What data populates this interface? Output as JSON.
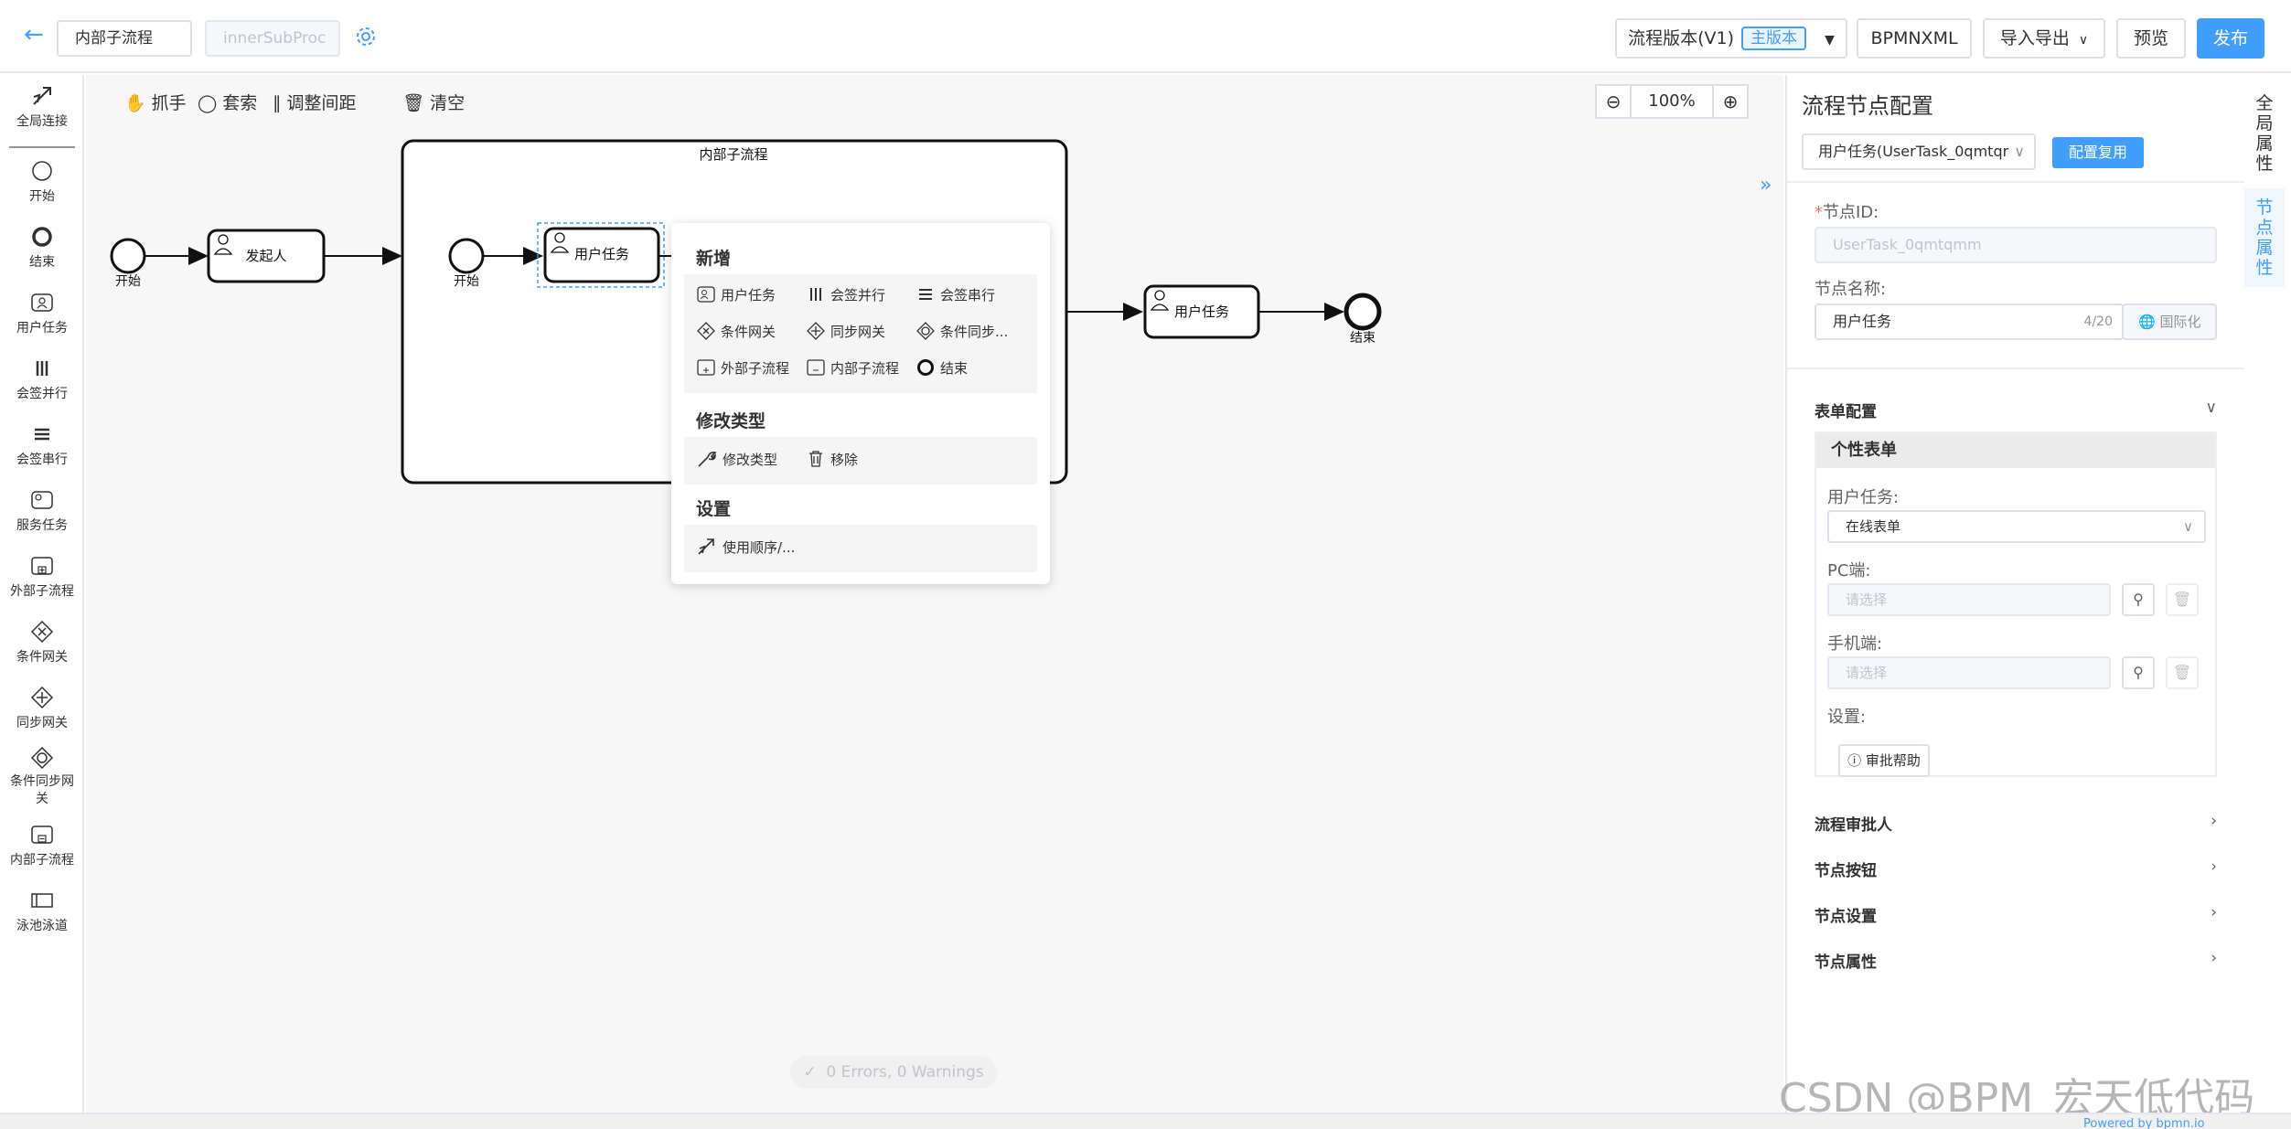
{
  "header": {
    "back_icon": "arrow-left-icon",
    "process_name": "内部子流程",
    "process_key": "innerSubProc",
    "version_label": "流程版本(V1)",
    "version_tag": "主版本",
    "bpmn_xml": "BPMNXML",
    "import_export": "导入导出",
    "preview": "预览",
    "publish": "发布",
    "accent": "#409eff"
  },
  "palette": {
    "items": [
      {
        "label": "全局连接",
        "icon": "global-connect-icon"
      },
      {
        "label": "开始",
        "icon": "start-event-icon"
      },
      {
        "label": "结束",
        "icon": "end-event-icon"
      },
      {
        "label": "用户任务",
        "icon": "user-task-icon"
      },
      {
        "label": "会签并行",
        "icon": "parallel-multi-icon"
      },
      {
        "label": "会签串行",
        "icon": "sequential-multi-icon"
      },
      {
        "label": "服务任务",
        "icon": "service-task-icon"
      },
      {
        "label": "外部子流程",
        "icon": "external-subprocess-icon"
      },
      {
        "label": "条件网关",
        "icon": "exclusive-gateway-icon"
      },
      {
        "label": "同步网关",
        "icon": "parallel-gateway-icon"
      },
      {
        "label": "条件同步网关",
        "icon": "inclusive-gateway-icon"
      },
      {
        "label": "内部子流程",
        "icon": "inner-subprocess-icon"
      },
      {
        "label": "泳池泳道",
        "icon": "pool-lane-icon"
      }
    ]
  },
  "toolbar": {
    "hand": "抓手",
    "lasso": "套索",
    "space": "调整间距",
    "clear": "清空",
    "zoom": "100%"
  },
  "diagram": {
    "subprocess_title": "内部子流程",
    "start1": "开始",
    "initiator": "发起人",
    "start2": "开始",
    "user_task_inner": "用户任务",
    "user_task_outer": "用户任务",
    "end": "结束"
  },
  "context_pad": {
    "add_title": "新增",
    "add_items": [
      "用户任务",
      "会签并行",
      "会签串行",
      "条件网关",
      "同步网关",
      "条件同步...",
      "外部子流程",
      "内部子流程",
      "结束"
    ],
    "modify_title": "修改类型",
    "modify_items": [
      "修改类型",
      "移除"
    ],
    "settings_title": "设置",
    "settings_items": [
      "使用顺序/..."
    ]
  },
  "status": "0 Errors, 0 Warnings",
  "panel": {
    "title": "流程节点配置",
    "node_select": "用户任务(UserTask_0qmtqr",
    "reuse_button": "配置复用",
    "node_id_label": "节点ID:",
    "node_id_value": "UserTask_0qmtqmm",
    "node_name_label": "节点名称:",
    "node_name_value": "用户任务",
    "node_name_count": "4/20",
    "i18n_button": "国际化",
    "form_section": "表单配置",
    "form_head": "个性表单",
    "user_task_label": "用户任务:",
    "user_task_select": "在线表单",
    "pc_label": "PC端:",
    "pc_placeholder": "请选择",
    "mobile_label": "手机端:",
    "mobile_placeholder": "请选择",
    "settings_label": "设置:",
    "help_button": "审批帮助",
    "sections": [
      "流程审批人",
      "节点按钮",
      "节点设置",
      "节点属性"
    ]
  },
  "vtabs": [
    "全局属性",
    "节点属性"
  ],
  "watermark": "CSDN @BPM_宏天低代码",
  "footer": "Powered by bpmn.io"
}
